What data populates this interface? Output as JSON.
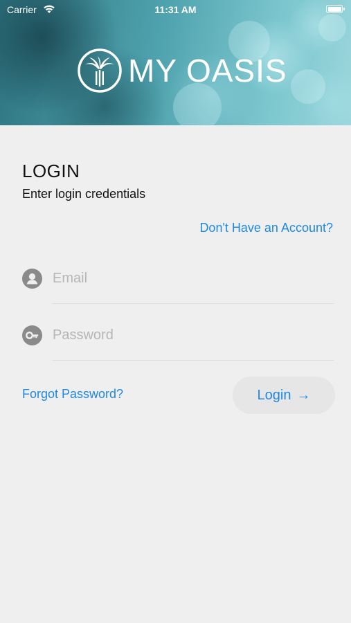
{
  "status_bar": {
    "carrier": "Carrier",
    "time": "11:31 AM",
    "icons": [
      "wifi-icon",
      "battery-icon"
    ]
  },
  "header": {
    "brand": "MY OASIS",
    "logo_icon": "palm-tree-icon",
    "text_color": "#ffffff"
  },
  "login": {
    "title": "LOGIN",
    "subtitle": "Enter login credentials",
    "signup_link": "Don't Have an Account?",
    "email": {
      "placeholder": "Email",
      "value": "",
      "icon": "user-icon"
    },
    "password": {
      "placeholder": "Password",
      "value": "",
      "icon": "key-icon"
    },
    "forgot_link": "Forgot Password?",
    "login_button": "Login",
    "login_arrow": "→"
  },
  "colors": {
    "accent": "#1e88e5",
    "background": "#efefef",
    "button_bg": "#e6e6e6",
    "icon_gray": "#8a8a8a"
  }
}
